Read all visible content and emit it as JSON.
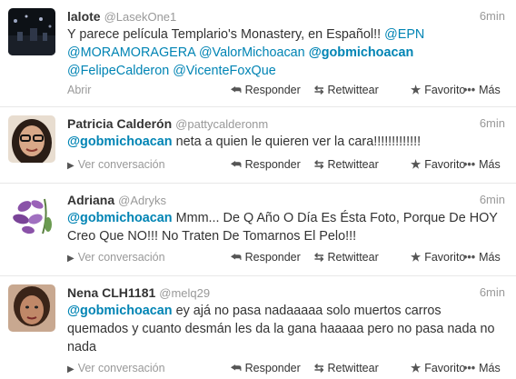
{
  "tweets": [
    {
      "name": "lalote",
      "handle": "@LasekOne1",
      "time": "6min",
      "text": [
        {
          "t": "Y parece película Templario's Monastery, en Español!! ",
          "c": "plain"
        },
        {
          "t": "@EPN",
          "c": "mention"
        },
        {
          "t": " ",
          "c": "plain"
        },
        {
          "t": "@MORAMORAGERA",
          "c": "mention"
        },
        {
          "t": " ",
          "c": "plain"
        },
        {
          "t": "@ValorMichoacan",
          "c": "mention"
        },
        {
          "t": " ",
          "c": "plain"
        },
        {
          "t": "@gobmichoacan",
          "c": "mention-bold"
        },
        {
          "t": " ",
          "c": "plain"
        },
        {
          "t": "@FelipeCalderon",
          "c": "mention"
        },
        {
          "t": " ",
          "c": "plain"
        },
        {
          "t": "@VicenteFoxQue",
          "c": "mention"
        }
      ],
      "expand_label": "Abrir",
      "expand_icon": "none"
    },
    {
      "name": "Patricia Calderón",
      "handle": "@pattycalderonm",
      "time": "6min",
      "text": [
        {
          "t": "@gobmichoacan",
          "c": "mention-bold"
        },
        {
          "t": " neta a quien le quieren ver la cara!!!!!!!!!!!!!",
          "c": "plain"
        }
      ],
      "expand_label": "Ver conversación",
      "expand_icon": "triangle-right-icon"
    },
    {
      "name": "Adriana",
      "handle": "@Adryks",
      "time": "6min",
      "text": [
        {
          "t": "@gobmichoacan",
          "c": "mention-bold"
        },
        {
          "t": " Mmm... De Q Año O Día Es Ésta Foto, Porque De HOY Creo Que NO!!! No Traten De Tomarnos El Pelo!!!",
          "c": "plain"
        }
      ],
      "expand_label": "Ver conversación",
      "expand_icon": "triangle-right-icon"
    },
    {
      "name": "Nena CLH1181",
      "handle": "@melq29",
      "time": "6min",
      "text": [
        {
          "t": "@gobmichoacan",
          "c": "mention-bold"
        },
        {
          "t": " ey ajá no pasa nadaaaaa solo muertos carros quemados y cuanto desmán les da la gana haaaaa pero no pasa nada no nada",
          "c": "plain"
        }
      ],
      "expand_label": "Ver conversación",
      "expand_icon": "triangle-right-icon"
    }
  ],
  "actions": {
    "reply": "Responder",
    "retweet": "Retwittear",
    "favorite": "Favorito",
    "more": "Más"
  },
  "colors": {
    "link": "#0084b4",
    "meta": "#999999",
    "divider": "#e8e8e8"
  }
}
